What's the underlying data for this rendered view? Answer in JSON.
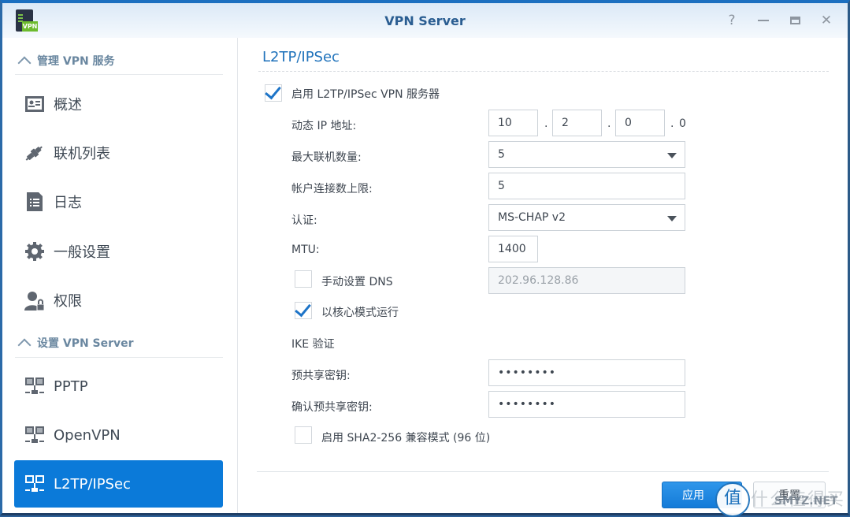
{
  "window": {
    "title": "VPN Server",
    "app_icon": "vpn-server-icon",
    "app_icon_badge": "VPN",
    "controls": {
      "help": "?",
      "minimize": "minimize-icon",
      "maximize": "maximize-icon",
      "close": "✕"
    }
  },
  "sidebar": {
    "section1": {
      "label": "管理 VPN 服务",
      "icon": "chevron-up-icon"
    },
    "items1": [
      {
        "label": "概述",
        "icon": "overview-icon"
      },
      {
        "label": "联机列表",
        "icon": "connection-plug-icon"
      },
      {
        "label": "日志",
        "icon": "log-icon"
      },
      {
        "label": "一般设置",
        "icon": "gear-icon"
      },
      {
        "label": "权限",
        "icon": "user-lock-icon"
      }
    ],
    "section2": {
      "label": "设置 VPN Server",
      "icon": "chevron-up-icon"
    },
    "items2": [
      {
        "label": "PPTP",
        "icon": "network-icon"
      },
      {
        "label": "OpenVPN",
        "icon": "network-icon"
      },
      {
        "label": "L2TP/IPSec",
        "icon": "network-icon",
        "active": true
      }
    ]
  },
  "main": {
    "title": "L2TP/IPSec",
    "enable": {
      "label": "启用 L2TP/IPSec VPN 服务器",
      "checked": true
    },
    "dynamic_ip": {
      "label": "动态 IP 地址:",
      "octets": [
        "10",
        "2",
        "0"
      ],
      "last": "0",
      "sep": "."
    },
    "max_conn": {
      "label": "最大联机数量:",
      "value": "5"
    },
    "account_limit": {
      "label": "帐户连接数上限:",
      "value": "5"
    },
    "auth": {
      "label": "认证:",
      "value": "MS-CHAP v2"
    },
    "mtu": {
      "label": "MTU:",
      "value": "1400"
    },
    "manual_dns": {
      "label": "手动设置 DNS",
      "checked": false,
      "value": "202.96.128.86"
    },
    "kernel_mode": {
      "label": "以核心模式运行",
      "checked": true
    },
    "ike_header": "IKE 验证",
    "psk": {
      "label": "预共享密钥:",
      "value": "••••••••"
    },
    "psk_confirm": {
      "label": "确认预共享密钥:",
      "value": "••••••••"
    },
    "sha2": {
      "label": "启用 SHA2-256 兼容模式 (96 位)",
      "checked": false
    }
  },
  "footer": {
    "apply": "应用",
    "reset": "重置"
  },
  "watermark": {
    "glyph": "值",
    "text": "什么值得买",
    "site": "SMYZ.NET"
  }
}
